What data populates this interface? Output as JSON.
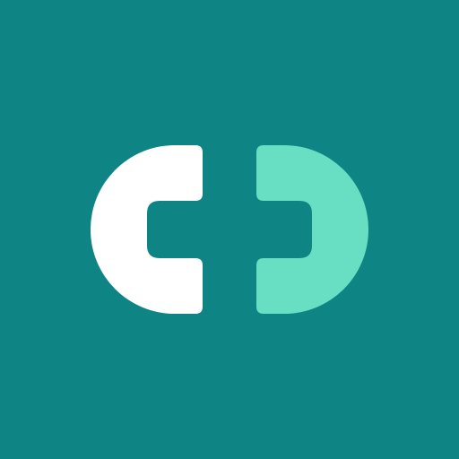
{
  "app_icon": {
    "icon": "interlocking-brackets-logo",
    "colors": {
      "background": "#0e8584",
      "left_shape": "#ffffff",
      "right_shape": "#68dec3"
    }
  }
}
